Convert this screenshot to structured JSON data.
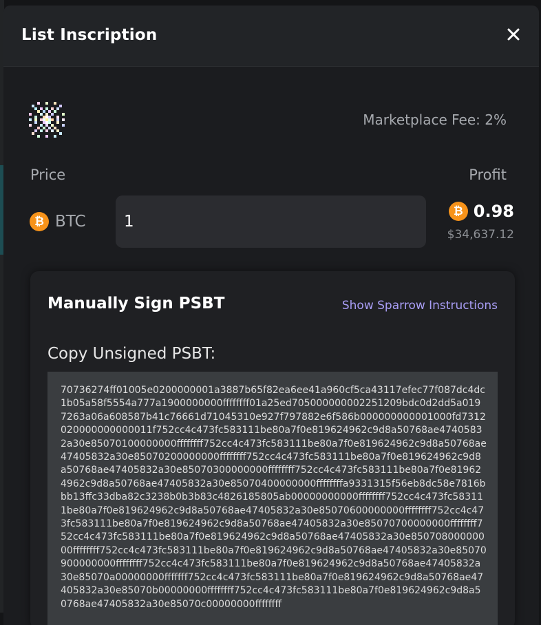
{
  "modal": {
    "title": "List Inscription"
  },
  "listing": {
    "marketplace_fee": "Marketplace Fee: 2%",
    "price_label": "Price",
    "profit_label": "Profit",
    "currency": "BTC",
    "price_value": "1",
    "profit_btc": "0.98",
    "profit_usd": "$34,637.12",
    "btc_color": "#f7931a"
  },
  "psbt": {
    "title": "Manually Sign PSBT",
    "sparrow_link": "Show Sparrow Instructions",
    "copy_label": "Copy Unsigned PSBT:",
    "text": "70736274ff01005e0200000001a3887b65f82ea6ee41a960cf5ca43117efec77f087dc4dc1b05a58f5554a777a1900000000ffffffff01a25ed705000000002251209bdc0d2dd5a0197263a06a608587b41c76661d71045310e927f797882e6f586b000000000001000fd7312020000000000011f752cc4c473fc583111be80a7f0e819624962c9d8a50768ae47405832a30e85070100000000ffffffff752cc4c473fc583111be80a7f0e819624962c9d8a50768ae47405832a30e85070200000000ffffffff752cc4c473fc583111be80a7f0e819624962c9d8a50768ae47405832a30e85070300000000ffffffff752cc4c473fc583111be80a7f0e819624962c9d8a50768ae47405832a30e85070400000000ffffffffa9331315f56eb8dc58e7816bbb13ffc33dba82c3238b0b3b83c4826185805ab00000000000ffffffff752cc4c473fc583111be80a7f0e819624962c9d8a50768ae47405832a30e85070600000000ffffffff752cc4c473fc583111be80a7f0e819624962c9d8a50768ae47405832a30e85070700000000ffffffff752cc4c473fc583111be80a7f0e819624962c9d8a50768ae47405832a30e85070800000000ffffffff752cc4c473fc583111be80a7f0e819624962c9d8a50768ae47405832a30e85070900000000ffffffff752cc4c473fc583111be80a7f0e819624962c9d8a50768ae47405832a30e85070a00000000fffffff752cc4c473fc583111be80a7f0e819624962c9d8a50768ae47405832a30e85070b00000000ffffffff752cc4c473fc583111be80a7f0e819624962c9d8a50768ae47405832a30e85070c00000000ffffffff"
  }
}
